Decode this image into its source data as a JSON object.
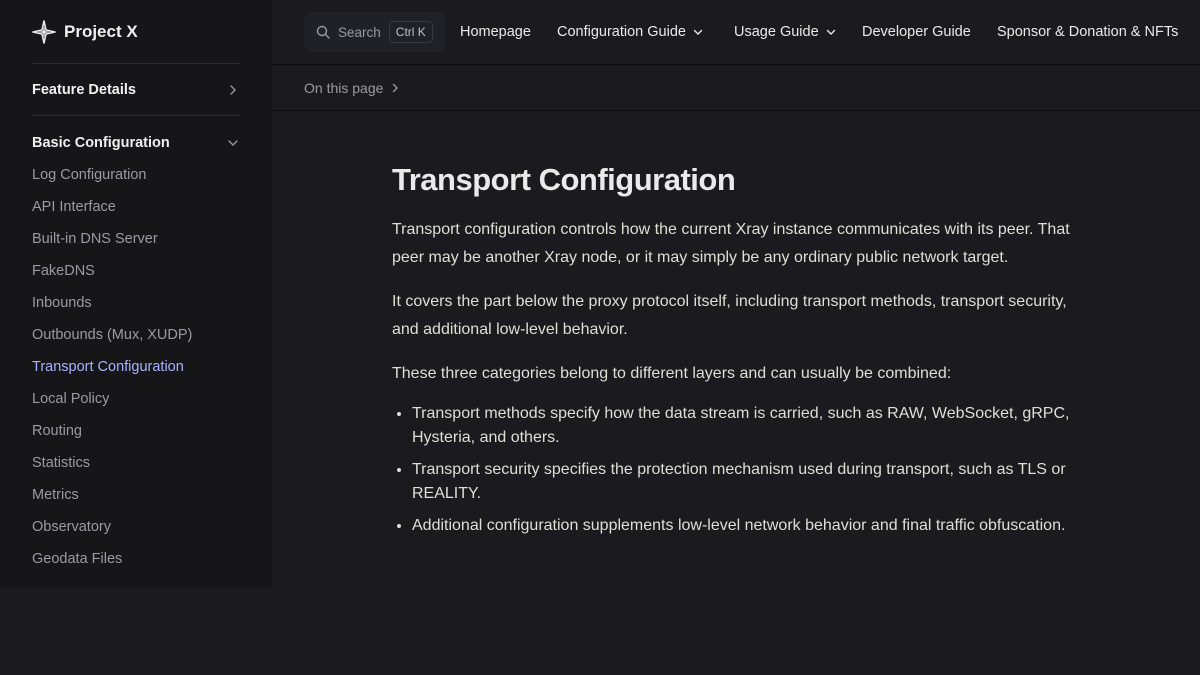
{
  "brand": {
    "name": "Project X"
  },
  "sidebar": {
    "collapsed_group": {
      "label": "Feature Details"
    },
    "expanded_group": {
      "label": "Basic Configuration",
      "items": [
        {
          "label": "Log Configuration"
        },
        {
          "label": "API Interface"
        },
        {
          "label": "Built-in DNS Server"
        },
        {
          "label": "FakeDNS"
        },
        {
          "label": "Inbounds"
        },
        {
          "label": "Outbounds (Mux, XUDP)"
        },
        {
          "label": "Transport Configuration",
          "active": true
        },
        {
          "label": "Local Policy"
        },
        {
          "label": "Routing"
        },
        {
          "label": "Statistics"
        },
        {
          "label": "Metrics"
        },
        {
          "label": "Observatory"
        },
        {
          "label": "Geodata Files"
        }
      ]
    }
  },
  "topnav": {
    "search": {
      "placeholder": "Search",
      "shortcut": "Ctrl K"
    },
    "links": [
      {
        "label": "Homepage",
        "dropdown": false
      },
      {
        "label": "Configuration Guide",
        "dropdown": true
      },
      {
        "label": "Usage Guide",
        "dropdown": true
      },
      {
        "label": "Developer Guide",
        "dropdown": false
      },
      {
        "label": "Sponsor & Donation & NFTs",
        "dropdown": false
      }
    ]
  },
  "localnav": {
    "label": "On this page"
  },
  "content": {
    "title": "Transport Configuration",
    "paragraphs": [
      "Transport configuration controls how the current Xray instance communicates with its peer. That peer may be another Xray node, or it may simply be any ordinary public network target.",
      "It covers the part below the proxy protocol itself, including transport methods, transport security, and additional low-level behavior.",
      "These three categories belong to different layers and can usually be combined:"
    ],
    "bullets": [
      "Transport methods specify how the data stream is carried, such as RAW, WebSocket, gRPC, Hysteria, and others.",
      "Transport security specifies the protection mechanism used during transport, such as TLS or REALITY.",
      "Additional configuration supplements low-level network behavior and final traffic obfuscation."
    ]
  },
  "colors": {
    "background": "#1b1b1f",
    "sidebar": "#161618",
    "active_link": "#a8b1ff",
    "text": "#dfdfd6",
    "muted": "#9a9aa2"
  }
}
